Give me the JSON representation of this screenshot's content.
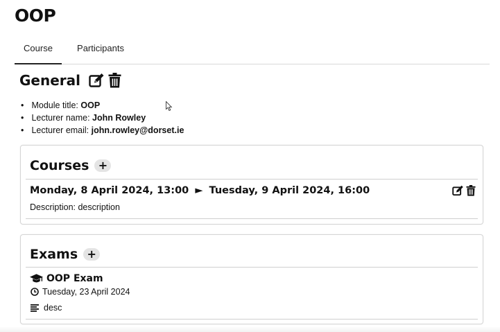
{
  "page": {
    "title": "OOP"
  },
  "tabs": [
    {
      "label": "Course",
      "active": true
    },
    {
      "label": "Participants",
      "active": false
    }
  ],
  "general": {
    "title": "General",
    "edit_icon": "edit-icon",
    "delete_icon": "trash-icon",
    "fields": [
      {
        "label": "Module title:",
        "value": "OOP"
      },
      {
        "label": "Lecturer name:",
        "value": "John Rowley"
      },
      {
        "label": "Lecturer email:",
        "value": "john.rowley@dorset.ie"
      }
    ]
  },
  "courses": {
    "title": "Courses",
    "add_label": "+",
    "items": [
      {
        "start": "Monday, 8 April 2024, 13:00",
        "arrow": "►",
        "end": "Tuesday, 9 April 2024, 16:00",
        "description_label": "Description:",
        "description": "description"
      }
    ]
  },
  "exams": {
    "title": "Exams",
    "add_label": "+",
    "items": [
      {
        "icon": "graduation-cap-icon",
        "name": "OOP Exam",
        "date_icon": "clock-icon",
        "date": "Tuesday, 23 April 2024",
        "desc_icon": "align-left-icon",
        "desc": "desc"
      }
    ]
  },
  "colors": {
    "text": "#111111",
    "border": "#d4d4d4",
    "add_button_bg": "#e4e4e4"
  }
}
